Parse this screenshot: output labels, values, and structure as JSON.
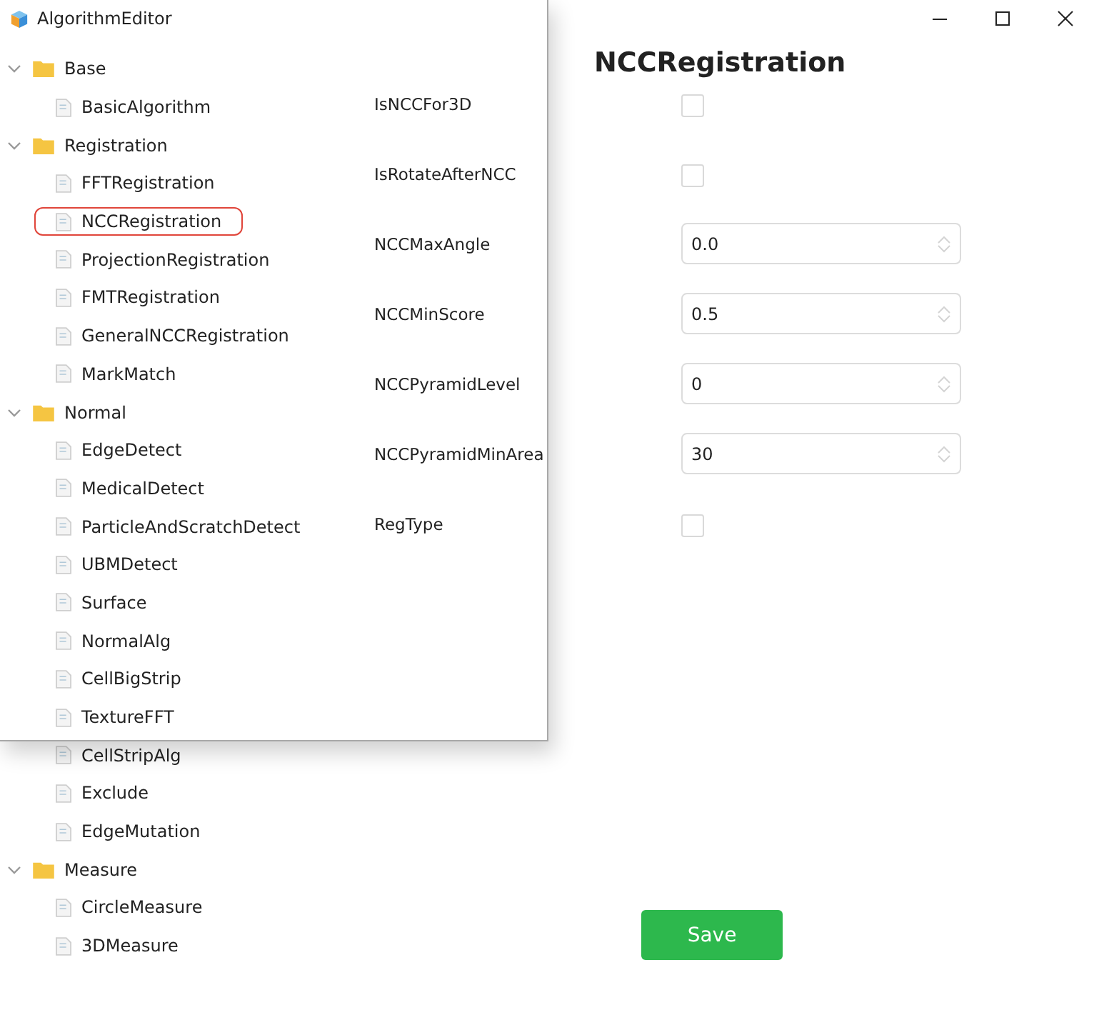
{
  "window": {
    "title": "AlgorithmEditor"
  },
  "tree": [
    {
      "label": "Base",
      "expanded": true,
      "children": [
        {
          "label": "BasicAlgorithm",
          "selected": false
        }
      ]
    },
    {
      "label": "Registration",
      "expanded": true,
      "children": [
        {
          "label": "FFTRegistration",
          "selected": false
        },
        {
          "label": "NCCRegistration",
          "selected": true
        },
        {
          "label": "ProjectionRegistration",
          "selected": false
        },
        {
          "label": "FMTRegistration",
          "selected": false
        },
        {
          "label": "GeneralNCCRegistration",
          "selected": false
        },
        {
          "label": "MarkMatch",
          "selected": false
        }
      ]
    },
    {
      "label": "Normal",
      "expanded": true,
      "children": [
        {
          "label": "EdgeDetect",
          "selected": false
        },
        {
          "label": "MedicalDetect",
          "selected": false
        },
        {
          "label": "ParticleAndScratchDetect",
          "selected": false
        },
        {
          "label": "UBMDetect",
          "selected": false
        },
        {
          "label": "Surface",
          "selected": false
        },
        {
          "label": "NormalAlg",
          "selected": false
        },
        {
          "label": "CellBigStrip",
          "selected": false
        },
        {
          "label": "TextureFFT",
          "selected": false
        },
        {
          "label": "CellStripAlg",
          "selected": false
        },
        {
          "label": "Exclude",
          "selected": false
        },
        {
          "label": "EdgeMutation",
          "selected": false
        }
      ]
    },
    {
      "label": "Measure",
      "expanded": true,
      "children": [
        {
          "label": "CircleMeasure",
          "selected": false
        },
        {
          "label": "3DMeasure",
          "selected": false
        }
      ]
    }
  ],
  "editor": {
    "title": "NCCRegistration",
    "properties": [
      {
        "label": "IsNCCFor3D",
        "kind": "checkbox",
        "checked": false
      },
      {
        "label": "IsRotateAfterNCC",
        "kind": "checkbox",
        "checked": false
      },
      {
        "label": "NCCMaxAngle",
        "kind": "number",
        "value": "0.0"
      },
      {
        "label": "NCCMinScore",
        "kind": "number",
        "value": "0.5"
      },
      {
        "label": "NCCPyramidLevel",
        "kind": "number",
        "value": "0"
      },
      {
        "label": "NCCPyramidMinArea",
        "kind": "number",
        "value": "30"
      },
      {
        "label": "RegType",
        "kind": "checkbox",
        "checked": false
      }
    ],
    "save_button": "Save"
  }
}
